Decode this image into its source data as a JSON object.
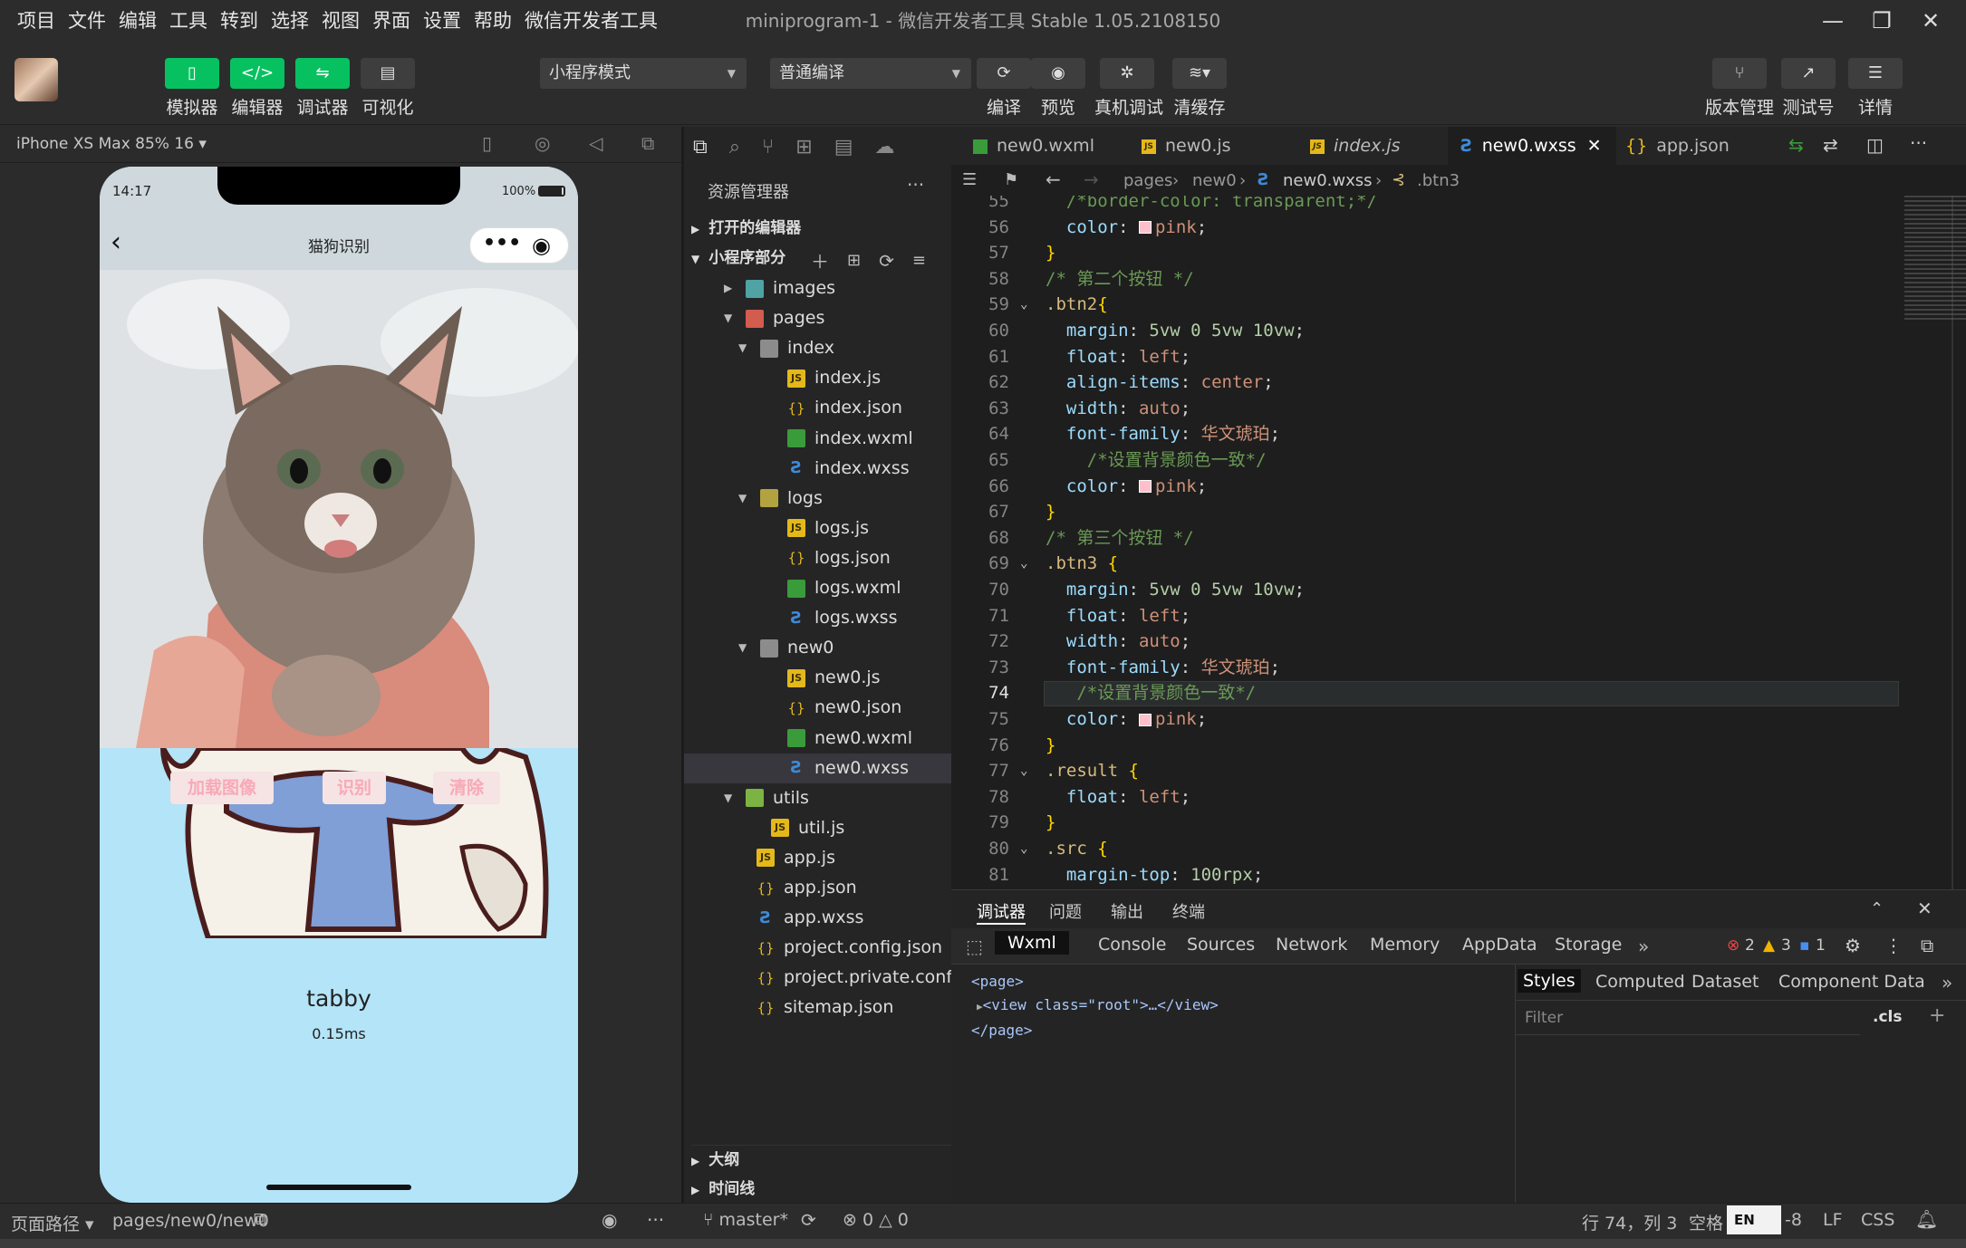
{
  "menubar": {
    "items": [
      "项目",
      "文件",
      "编辑",
      "工具",
      "转到",
      "选择",
      "视图",
      "界面",
      "设置",
      "帮助",
      "微信开发者工具"
    ],
    "title": "miniprogram-1 - 微信开发者工具 Stable 1.05.2108150",
    "minimize": "—",
    "maximize": "❐",
    "close": "✕"
  },
  "toolbar": {
    "simulator": "模拟器",
    "editor": "编辑器",
    "debugger": "调试器",
    "visual": "可视化",
    "mode_select": "小程序模式",
    "compile_select": "普通编译",
    "compile": "编译",
    "preview": "预览",
    "real_debug": "真机调试",
    "clear_cache": "清缓存",
    "version": "版本管理",
    "test_account": "测试号",
    "details": "详情"
  },
  "simulator": {
    "device": "iPhone XS Max 85% 16",
    "time": "14:17",
    "battery": "100%",
    "nav_title": "猫狗识别",
    "btn_load": "加载图像",
    "btn_identify": "识别",
    "btn_clear": "清除",
    "result": "tabby",
    "elapsed": "0.15ms"
  },
  "explorer": {
    "title": "资源管理器",
    "open_editors": "打开的编辑器",
    "section": "小程序部分",
    "items": [
      {
        "name": "images",
        "type": "folder img",
        "level": 1,
        "open": false
      },
      {
        "name": "pages",
        "type": "folder pages",
        "level": 1,
        "open": true
      },
      {
        "name": "index",
        "type": "folder",
        "level": 2,
        "open": true
      },
      {
        "name": "index.js",
        "type": "js",
        "level": 3
      },
      {
        "name": "index.json",
        "type": "json",
        "level": 3
      },
      {
        "name": "index.wxml",
        "type": "wxml",
        "level": 3
      },
      {
        "name": "index.wxss",
        "type": "wxss",
        "level": 3
      },
      {
        "name": "logs",
        "type": "folder logs",
        "level": 2,
        "open": true
      },
      {
        "name": "logs.js",
        "type": "js",
        "level": 3
      },
      {
        "name": "logs.json",
        "type": "json",
        "level": 3
      },
      {
        "name": "logs.wxml",
        "type": "wxml",
        "level": 3
      },
      {
        "name": "logs.wxss",
        "type": "wxss",
        "level": 3
      },
      {
        "name": "new0",
        "type": "folder",
        "level": 2,
        "open": true
      },
      {
        "name": "new0.js",
        "type": "js",
        "level": 3
      },
      {
        "name": "new0.json",
        "type": "json",
        "level": 3
      },
      {
        "name": "new0.wxml",
        "type": "wxml",
        "level": 3
      },
      {
        "name": "new0.wxss",
        "type": "wxss",
        "level": 3,
        "selected": true
      },
      {
        "name": "utils",
        "type": "folder utils",
        "level": 1,
        "open": true
      },
      {
        "name": "util.js",
        "type": "js",
        "level": 2
      },
      {
        "name": "app.js",
        "type": "js",
        "level": 1
      },
      {
        "name": "app.json",
        "type": "json",
        "level": 1
      },
      {
        "name": "app.wxss",
        "type": "wxss",
        "level": 1
      },
      {
        "name": "project.config.json",
        "type": "json",
        "level": 1
      },
      {
        "name": "project.private.config.js...",
        "type": "json",
        "level": 1
      },
      {
        "name": "sitemap.json",
        "type": "json",
        "level": 1
      }
    ],
    "outline": "大纲",
    "timeline": "时间线"
  },
  "editor": {
    "tabs": [
      {
        "name": "new0.wxml",
        "type": "wxml"
      },
      {
        "name": "new0.js",
        "type": "js"
      },
      {
        "name": "index.js",
        "type": "js"
      },
      {
        "name": "new0.wxss",
        "type": "wxss",
        "active": true
      },
      {
        "name": "app.json",
        "type": "json"
      }
    ],
    "breadcrumb": [
      "pages",
      "new0",
      "new0.wxss",
      ".btn3"
    ],
    "lines": [
      {
        "n": "55",
        "t": "  /*border-color: transparent;*/",
        "k": "com"
      },
      {
        "n": "56",
        "t": "  color: pink;",
        "k": "color"
      },
      {
        "n": "57",
        "t": "}",
        "k": "brace"
      },
      {
        "n": "58",
        "t": "/* 第二个按钮 */",
        "k": "com0"
      },
      {
        "n": "59",
        "t": ".btn2{",
        "k": "sel"
      },
      {
        "n": "60",
        "t": "  margin: 5vw 0 5vw 10vw;",
        "k": "margin"
      },
      {
        "n": "61",
        "t": "  float: left;",
        "k": "prop",
        "p": "float",
        "v": "left"
      },
      {
        "n": "62",
        "t": "  align-items: center;",
        "k": "prop",
        "p": "align-items",
        "v": "center"
      },
      {
        "n": "63",
        "t": "  width: auto;",
        "k": "prop",
        "p": "width",
        "v": "auto"
      },
      {
        "n": "64",
        "t": "  font-family: 华文琥珀;",
        "k": "prop",
        "p": "font-family",
        "v": "华文琥珀"
      },
      {
        "n": "65",
        "t": "    /*设置背景颜色一致*/",
        "k": "com"
      },
      {
        "n": "66",
        "t": "  color: pink;",
        "k": "color"
      },
      {
        "n": "67",
        "t": "}",
        "k": "brace"
      },
      {
        "n": "68",
        "t": "/* 第三个按钮 */",
        "k": "com0"
      },
      {
        "n": "69",
        "t": ".btn3 {",
        "k": "sel"
      },
      {
        "n": "70",
        "t": "  margin: 5vw 0 5vw 10vw;",
        "k": "margin"
      },
      {
        "n": "71",
        "t": "  float: left;",
        "k": "prop",
        "p": "float",
        "v": "left"
      },
      {
        "n": "72",
        "t": "  width: auto;",
        "k": "prop",
        "p": "width",
        "v": "auto"
      },
      {
        "n": "73",
        "t": "  font-family: 华文琥珀;",
        "k": "prop",
        "p": "font-family",
        "v": "华文琥珀"
      },
      {
        "n": "74",
        "t": "   /*设置背景颜色一致*/",
        "k": "com"
      },
      {
        "n": "75",
        "t": "  color: pink;",
        "k": "color"
      },
      {
        "n": "76",
        "t": "}",
        "k": "brace"
      },
      {
        "n": "77",
        "t": ".result {",
        "k": "sel"
      },
      {
        "n": "78",
        "t": "  float: left;",
        "k": "prop",
        "p": "float",
        "v": "left"
      },
      {
        "n": "79",
        "t": "}",
        "k": "brace"
      },
      {
        "n": "80",
        "t": ".src {",
        "k": "sel"
      },
      {
        "n": "81",
        "t": "  margin-top: 100rpx;",
        "k": "mtop"
      }
    ]
  },
  "debugger": {
    "panel_tabs": [
      "调试器",
      "问题",
      "输出",
      "终端"
    ],
    "tabs": [
      "Wxml",
      "Console",
      "Sources",
      "Network",
      "Memory",
      "AppData",
      "Storage"
    ],
    "errors": "2",
    "warnings": "3",
    "infos": "1",
    "dom": [
      "<page>",
      "<view class=\"root\">…</view>",
      "</page>"
    ],
    "side_tabs": [
      "Styles",
      "Computed",
      "Dataset",
      "Component Data"
    ],
    "filter_placeholder": "Filter",
    "cls": ".cls"
  },
  "statusbar": {
    "page_path_label": "页面路径",
    "page_path": "pages/new0/new0",
    "branch": "master*",
    "err_count": "0",
    "warn_count": "0",
    "cursor": "行 74，列 3",
    "indent": "空格",
    "eol": "LF",
    "lang": "CSS",
    "ime": "EN",
    "encoding_tail": "-8"
  }
}
